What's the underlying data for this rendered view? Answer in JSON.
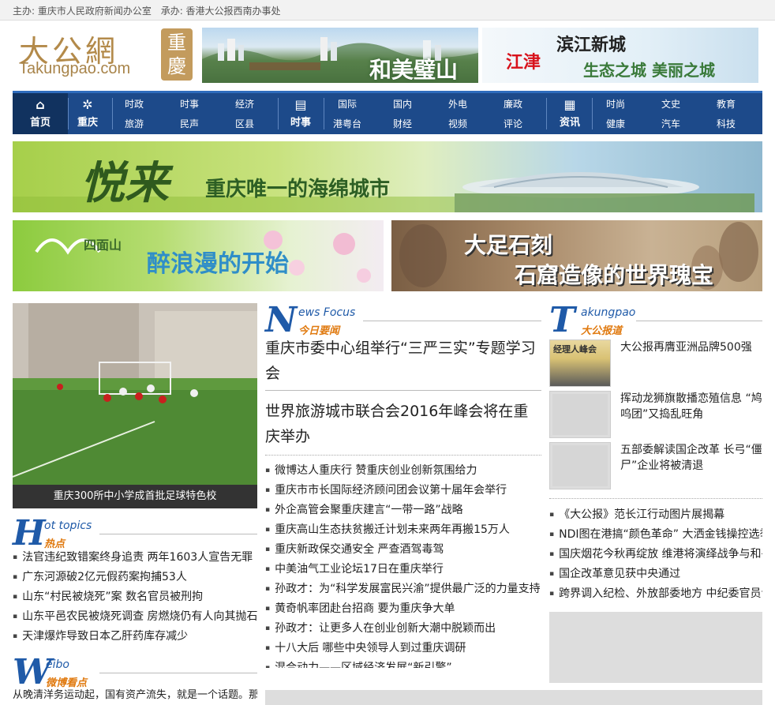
{
  "top_bar": {
    "host": "主办: 重庆市人民政府新闻办公室",
    "organizer": "承办: 香港大公报西南办事处"
  },
  "logo": {
    "cn": "大公網",
    "en": "Takungpao.com",
    "badge_1": "重",
    "badge_2": "慶"
  },
  "banners": {
    "top_1": "和美璧山",
    "top_2_city": "江津",
    "top_2_brand": "滨江新城",
    "top_2_slogan": "生态之城 美丽之城",
    "wide_title": "悦来",
    "wide_slogan": "重庆唯一的海绵城市",
    "left_logo": "四面山",
    "left_slogan": "醉浪漫的开始",
    "right_title": "大足石刻",
    "right_slogan": "石窟造像的世界瑰宝"
  },
  "nav": {
    "home": "首页",
    "chongqing": "重庆",
    "news": "时事",
    "info": "资讯",
    "group1": [
      "时政",
      "时事",
      "经济",
      "旅游",
      "民声",
      "区县"
    ],
    "group2": [
      "国际",
      "国内",
      "外电",
      "廉政",
      "港粤台",
      "财经",
      "视频",
      "评论"
    ],
    "group3": [
      "时尚",
      "文史",
      "教育",
      "健康",
      "汽车",
      "科技"
    ]
  },
  "feature_photo": {
    "caption": "重庆300所中小学成首批足球特色校"
  },
  "hot_topics": {
    "letter": "H",
    "en": "ot topics",
    "cn": "热点",
    "items": [
      "法官违纪致错案终身追责  两年1603人宣告无罪",
      "广东河源破2亿元假药案拘捕53人",
      "山东“村民被烧死”案  数名官员被刑拘",
      "山东平邑农民被烧死调查  房燃烧仍有人向其抛石",
      "天津爆炸导致日本乙肝药库存减少"
    ]
  },
  "weibo": {
    "letter": "W",
    "en": "eibo",
    "cn": "微博看点",
    "text": "从晚清洋务运动起，国有资产流失，就是一个话题。那些"
  },
  "news_focus": {
    "letter": "N",
    "en": "ews Focus",
    "cn": "今日要闻",
    "headline_1": "重庆市委中心组举行“三严三实”专题学习会",
    "headline_2": "世界旅游城市联合会2016年峰会将在重庆举办",
    "items": [
      "微博达人重庆行  赞重庆创业创新氛围给力",
      "重庆市市长国际经济顾问团会议第十届年会举行",
      "外企高管会聚重庆建言“一带一路”战略",
      "重庆高山生态扶贫搬迁计划未来两年再搬15万人",
      "重庆新政保交通安全  严查酒驾毒驾",
      "中美油气工业论坛17日在重庆举行",
      "孙政才：为“科学发展富民兴渝”提供最广泛的力量支持",
      "黄奇帆率团赴台招商  要为重庆争大单",
      "孙政才：让更多人在创业创新大潮中脱颖而出",
      "十八大后  哪些中央领导人到过重庆调研",
      "混合动力——区域经济发展“新引擎”"
    ]
  },
  "takungpao": {
    "letter": "T",
    "en": "akungpao",
    "cn": "大公报道",
    "feature_1": "大公报再膺亚洲品牌500强",
    "feature_2": "挥动龙狮旗散播恋殖信息 “鸠呜团”又捣乱旺角",
    "feature_3": "五部委解读国企改革  长弓“僵尸”企业将被清退",
    "thumb_1_text": "经理人峰会",
    "items": [
      "《大公报》范长江行动图片展揭幕",
      "NDI图在港搞“颜色革命”  大洒金钱操控选举",
      "国庆烟花今秋再绽放  维港将演绎战争与和平",
      "国企改革意见获中央通过",
      "跨界调入纪检、外放部委地方  中纪委官员调动频繁"
    ]
  },
  "colors": {
    "nav_bg": "#1d4a8a",
    "accent_blue": "#1f5aa8",
    "accent_orange": "#e07a10"
  }
}
